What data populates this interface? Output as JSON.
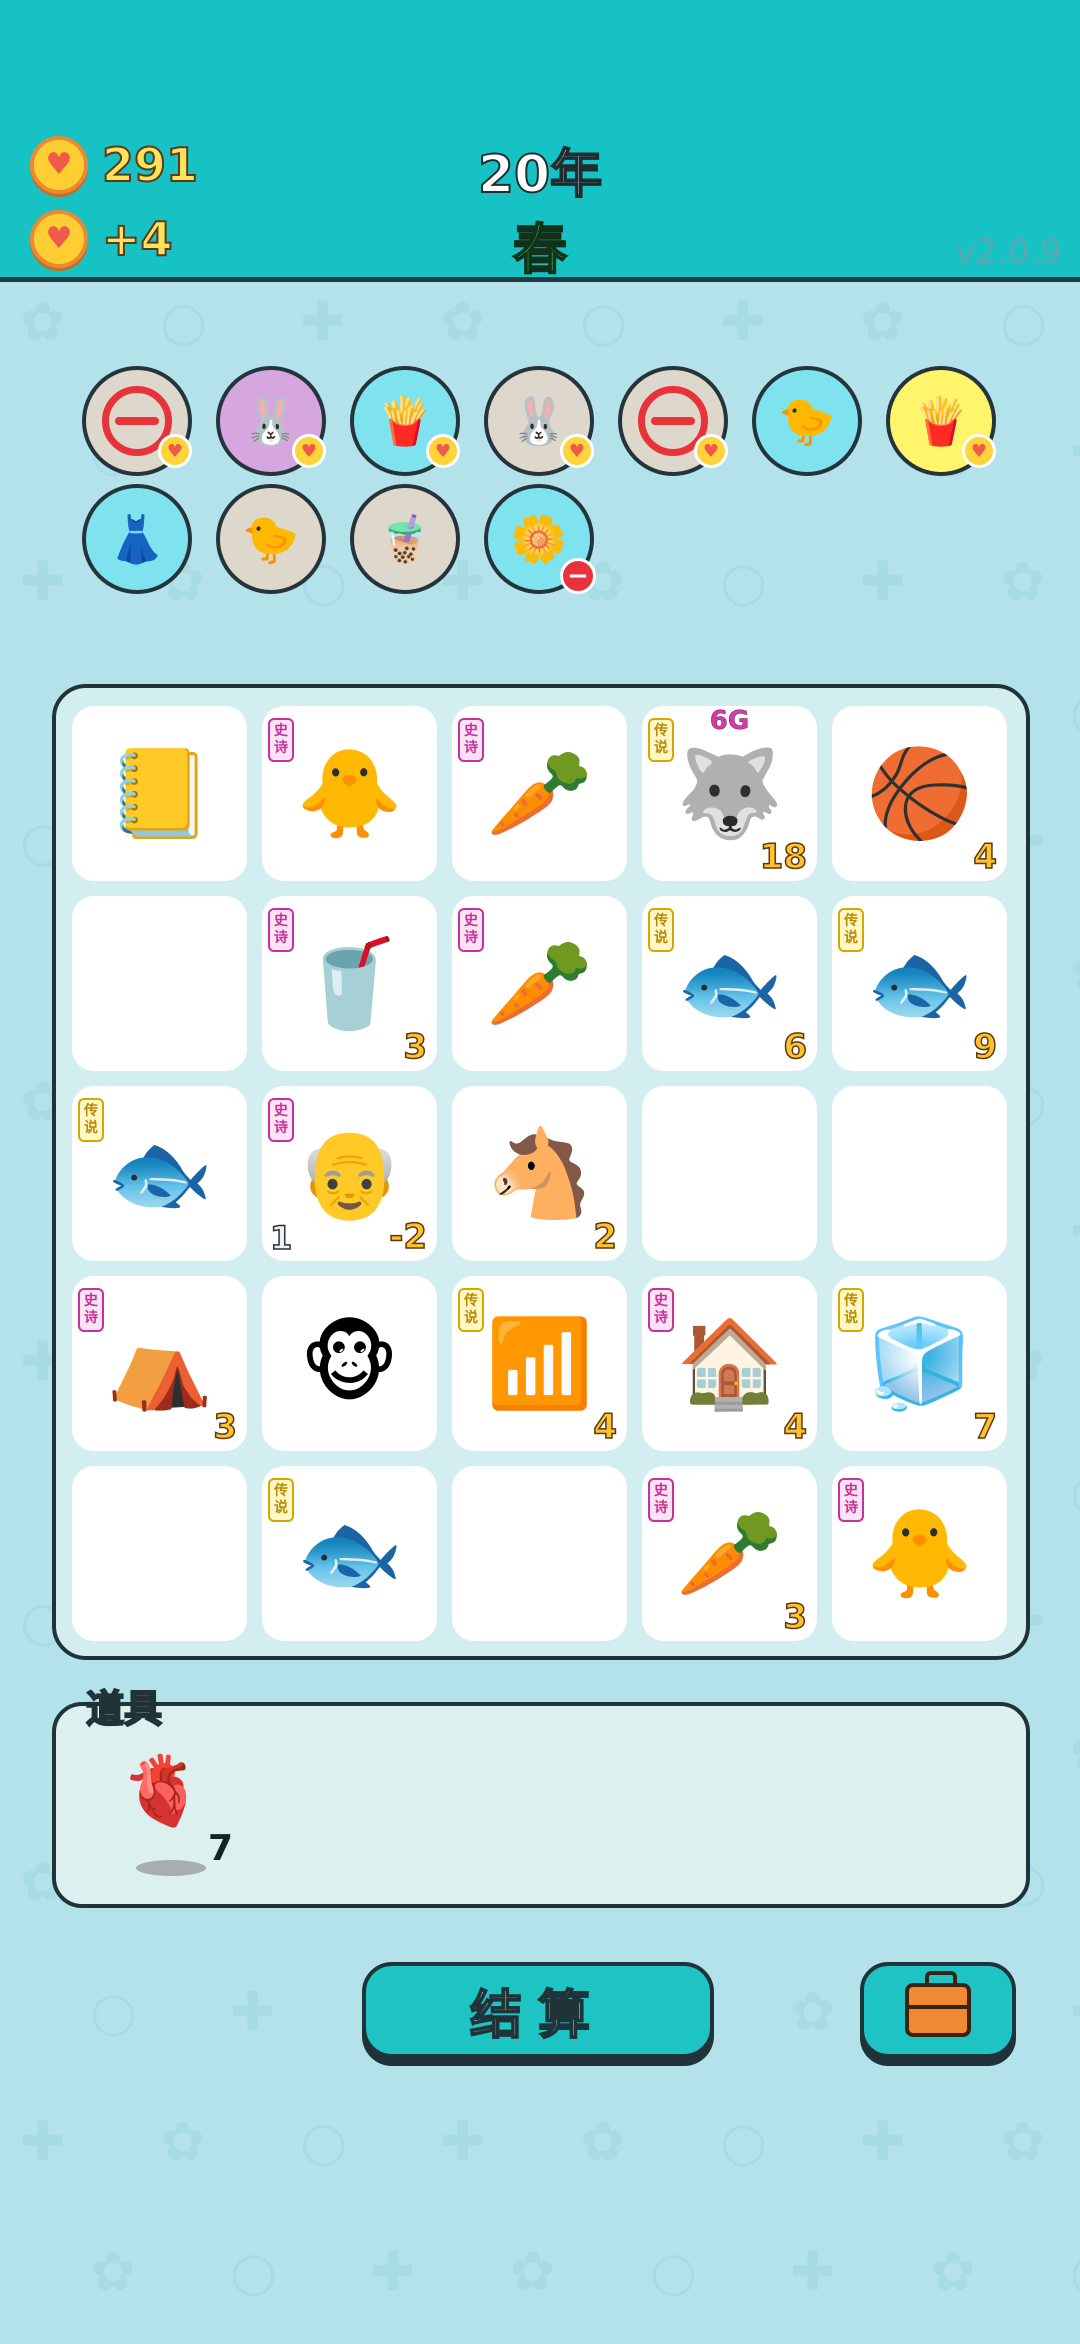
{
  "header": {
    "coins": "291",
    "income": "+4",
    "year": "20年",
    "season": "春",
    "version": "v2.0.9"
  },
  "relics": [
    {
      "name": "no-entry",
      "icon": "no-sign",
      "bg": "#ddd7cc",
      "badge": true
    },
    {
      "name": "rabbit",
      "icon": "🐰",
      "bg": "#d6a6df",
      "badge": true
    },
    {
      "name": "fries",
      "icon": "🍟",
      "bg": "#7fe3ef",
      "badge": true
    },
    {
      "name": "rabbit",
      "icon": "🐰",
      "bg": "#ddd7cc",
      "badge": true
    },
    {
      "name": "no-entry",
      "icon": "no-sign",
      "bg": "#ddd7cc",
      "badge": true
    },
    {
      "name": "chick-egg",
      "icon": "🐤",
      "bg": "#7fe3ef",
      "badge": false
    },
    {
      "name": "fries",
      "icon": "🍟",
      "bg": "#fff56a",
      "badge": true
    },
    {
      "name": "skirt",
      "icon": "👗",
      "bg": "#7fe3ef",
      "badge": false
    },
    {
      "name": "chick-egg",
      "icon": "🐤",
      "bg": "#ddd7cc",
      "badge": false
    },
    {
      "name": "tea-cup",
      "icon": "🧋",
      "bg": "#ddd7cc",
      "badge": false
    },
    {
      "name": "flower-pot",
      "icon": "🌼",
      "bg": "#7fe3ef",
      "badge": false,
      "minus": true
    }
  ],
  "board": [
    [
      {
        "icon": "📒",
        "tag": "",
        "count": ""
      },
      {
        "icon": "🐥",
        "tag": "史诗",
        "count": ""
      },
      {
        "icon": "🥕",
        "tag": "史诗",
        "count": ""
      },
      {
        "icon": "🐺",
        "tag": "传说",
        "count": "18",
        "top": "6G"
      },
      {
        "icon": "🏀",
        "tag": "",
        "count": "4"
      }
    ],
    [
      {
        "icon": "",
        "tag": "",
        "count": ""
      },
      {
        "icon": "🥤",
        "tag": "史诗",
        "count": "3"
      },
      {
        "icon": "🥕",
        "tag": "史诗",
        "count": ""
      },
      {
        "icon": "🐟",
        "tag": "传说",
        "count": "6"
      },
      {
        "icon": "🐟",
        "tag": "传说",
        "count": "9"
      }
    ],
    [
      {
        "icon": "🐟",
        "tag": "传说",
        "count": ""
      },
      {
        "icon": "👴",
        "tag": "史诗",
        "count": "-2",
        "left": "1"
      },
      {
        "icon": "🐴",
        "tag": "",
        "count": "2"
      },
      {
        "icon": "",
        "tag": "",
        "count": ""
      },
      {
        "icon": "",
        "tag": "",
        "count": ""
      }
    ],
    [
      {
        "icon": "⛺",
        "tag": "史诗",
        "count": "3"
      },
      {
        "icon": "🐵",
        "tag": "",
        "count": ""
      },
      {
        "icon": "📶",
        "tag": "传说",
        "count": "4"
      },
      {
        "icon": "🏠",
        "tag": "史诗",
        "count": "4"
      },
      {
        "icon": "🧊",
        "tag": "传说",
        "count": "7"
      }
    ],
    [
      {
        "icon": "",
        "tag": "",
        "count": ""
      },
      {
        "icon": "🐟",
        "tag": "传说",
        "count": ""
      },
      {
        "icon": "",
        "tag": "",
        "count": ""
      },
      {
        "icon": "🥕",
        "tag": "史诗",
        "count": "3"
      },
      {
        "icon": "🐥",
        "tag": "史诗",
        "count": ""
      }
    ]
  ],
  "items": {
    "label": "道具",
    "list": [
      {
        "icon": "🫀",
        "qty": "7"
      }
    ]
  },
  "buttons": {
    "settle": "结算"
  },
  "colors": {
    "header_bg": "#17c2c4",
    "page_bg": "#b4e2ea",
    "count_text": "#ffc22c",
    "epic_tag": "#c8309b",
    "legend_tag": "#d5a800"
  }
}
